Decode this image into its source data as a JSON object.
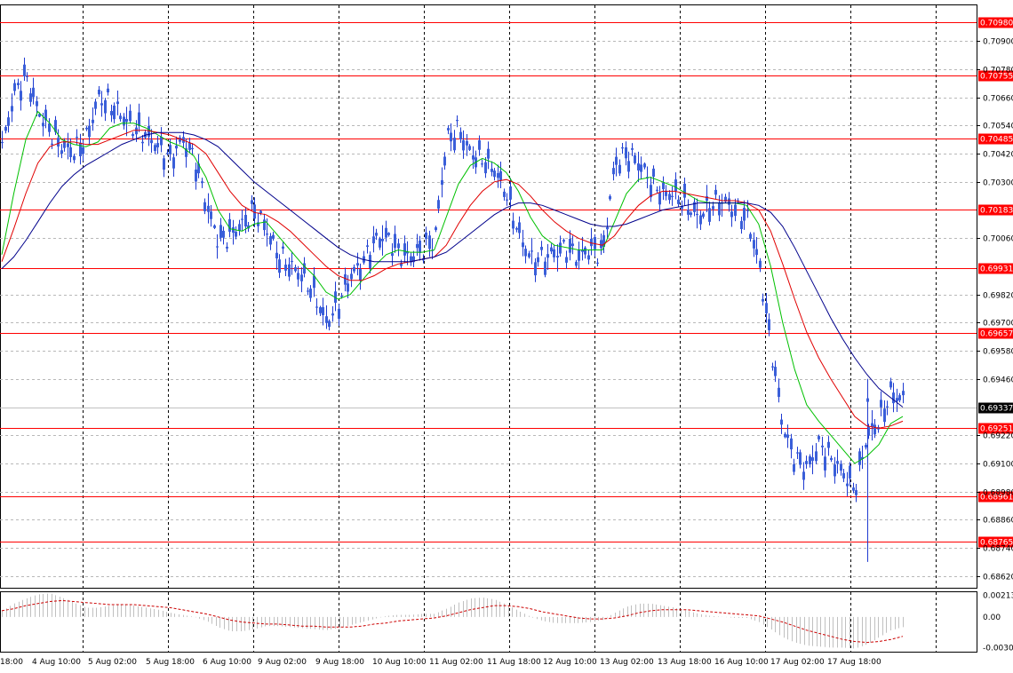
{
  "chart_data": {
    "type": "candlestick",
    "grid": true,
    "price_range": [
      0.6857,
      0.7106
    ],
    "y_ticks": [
      "0.70900",
      "0.70780",
      "0.70660",
      "0.70540",
      "0.70420",
      "0.70300",
      "0.70060",
      "0.69820",
      "0.69700",
      "0.69580",
      "0.69460",
      "0.69220",
      "0.69100",
      "0.68980",
      "0.68860",
      "0.68740",
      "0.68620"
    ],
    "level_lines": [
      "0.70980",
      "0.70755",
      "0.70485",
      "0.70183",
      "0.69931",
      "0.69657",
      "0.69251",
      "0.68961",
      "0.68765"
    ],
    "current_price": "0.69337",
    "x_labels": [
      "4 Aug 10:00",
      "5 Aug 02:00",
      "5 Aug 18:00",
      "6 Aug 10:00",
      "9 Aug 02:00",
      "9 Aug 18:00",
      "10 Aug 10:00",
      "11 Aug 02:00",
      "11 Aug 18:00",
      "12 Aug 10:00",
      "13 Aug 02:00",
      "13 Aug 18:00",
      "16 Aug 10:00",
      "17 Aug 02:00",
      "17 Aug 18:00"
    ],
    "x_label_partial": "18:00",
    "indicator": {
      "y_ticks": [
        "0.00213",
        "0.00",
        "-0.00302"
      ],
      "y_range": [
        -0.0034,
        0.0025
      ]
    },
    "series": [
      {
        "color": "#0000ff",
        "values": [
          0.7045,
          0.7068,
          0.7075,
          0.706,
          0.7052,
          0.7045,
          0.7043,
          0.7048,
          0.7066,
          0.7063,
          0.7058,
          0.7053,
          0.705,
          0.7045,
          0.704,
          0.7048,
          0.704,
          0.702,
          0.7005,
          0.7008,
          0.7012,
          0.7018,
          0.701,
          0.6998,
          0.6994,
          0.699,
          0.6982,
          0.697,
          0.6978,
          0.699,
          0.6995,
          0.7005,
          0.7007,
          0.7,
          0.6998,
          0.7002,
          0.7005,
          0.7048,
          0.7052,
          0.7042,
          0.704,
          0.7035,
          0.7025,
          0.7008,
          0.6997,
          0.6997,
          0.7,
          0.7002,
          0.6998,
          0.7002,
          0.7,
          0.7038,
          0.7042,
          0.7038,
          0.703,
          0.7025,
          0.7025,
          0.702,
          0.7015,
          0.702,
          0.7022,
          0.7018,
          0.7015,
          0.6995,
          0.696,
          0.6925,
          0.6912,
          0.6908,
          0.6918,
          0.6912,
          0.6906,
          0.6899,
          0.6922,
          0.6928,
          0.694,
          0.6937
        ]
      },
      {
        "color": "#00c000",
        "values": [
          0.6999,
          0.7025,
          0.7048,
          0.706,
          0.7055,
          0.7048,
          0.7046,
          0.7045,
          0.7047,
          0.7053,
          0.7055,
          0.7055,
          0.7053,
          0.705,
          0.7047,
          0.7045,
          0.7041,
          0.7032,
          0.7018,
          0.701,
          0.7009,
          0.7012,
          0.7013,
          0.7007,
          0.7001,
          0.6995,
          0.699,
          0.6983,
          0.698,
          0.6982,
          0.6988,
          0.6994,
          0.6999,
          0.7001,
          0.7,
          0.7,
          0.7001,
          0.7015,
          0.7029,
          0.7037,
          0.704,
          0.7038,
          0.7034,
          0.7026,
          0.7015,
          0.7007,
          0.7003,
          0.7002,
          0.7001,
          0.7001,
          0.7001,
          0.7013,
          0.7025,
          0.7031,
          0.7032,
          0.703,
          0.7028,
          0.7025,
          0.7022,
          0.7021,
          0.7021,
          0.7021,
          0.702,
          0.7012,
          0.6994,
          0.697,
          0.695,
          0.6935,
          0.6928,
          0.6922,
          0.6916,
          0.691,
          0.6913,
          0.6918,
          0.6927,
          0.693
        ]
      },
      {
        "color": "#e00000",
        "values": [
          0.6996,
          0.701,
          0.7025,
          0.7038,
          0.7045,
          0.7047,
          0.7047,
          0.7046,
          0.7046,
          0.7048,
          0.705,
          0.7052,
          0.7052,
          0.7051,
          0.705,
          0.7048,
          0.7046,
          0.7042,
          0.7034,
          0.7026,
          0.702,
          0.7017,
          0.7016,
          0.7013,
          0.7009,
          0.7004,
          0.6999,
          0.6994,
          0.699,
          0.6988,
          0.6988,
          0.699,
          0.6993,
          0.6995,
          0.6996,
          0.6997,
          0.6998,
          0.7003,
          0.7012,
          0.702,
          0.7026,
          0.703,
          0.7031,
          0.7029,
          0.7024,
          0.7018,
          0.7013,
          0.7009,
          0.7006,
          0.7004,
          0.7003,
          0.7007,
          0.7014,
          0.702,
          0.7024,
          0.7026,
          0.7026,
          0.7025,
          0.7024,
          0.7023,
          0.7022,
          0.7022,
          0.7021,
          0.7018,
          0.7009,
          0.6995,
          0.698,
          0.6966,
          0.6955,
          0.6946,
          0.6938,
          0.693,
          0.6926,
          0.6925,
          0.6926,
          0.6928
        ]
      },
      {
        "color": "#00008b",
        "values": [
          0.6993,
          0.6998,
          0.7005,
          0.7013,
          0.7021,
          0.7028,
          0.7033,
          0.7037,
          0.704,
          0.7043,
          0.7046,
          0.7048,
          0.705,
          0.7051,
          0.7051,
          0.7051,
          0.705,
          0.7048,
          0.7045,
          0.704,
          0.7035,
          0.703,
          0.7026,
          0.7022,
          0.7018,
          0.7014,
          0.701,
          0.7006,
          0.7002,
          0.6999,
          0.6997,
          0.6996,
          0.6996,
          0.6996,
          0.6996,
          0.6997,
          0.6998,
          0.7,
          0.7004,
          0.7008,
          0.7012,
          0.7016,
          0.7019,
          0.7021,
          0.7021,
          0.702,
          0.7018,
          0.7016,
          0.7014,
          0.7012,
          0.7011,
          0.7011,
          0.7012,
          0.7014,
          0.7016,
          0.7018,
          0.7019,
          0.702,
          0.7021,
          0.7021,
          0.7021,
          0.7021,
          0.7021,
          0.702,
          0.7017,
          0.7011,
          0.7002,
          0.6992,
          0.6982,
          0.6972,
          0.6963,
          0.6955,
          0.6948,
          0.6942,
          0.6938,
          0.6934
        ]
      },
      {
        "color": "#c0c0c0",
        "values": [
          0.0006,
          0.0013,
          0.0018,
          0.0022,
          0.0023,
          0.0019,
          0.0014,
          0.0009,
          0.0009,
          0.0011,
          0.0012,
          0.0011,
          0.0009,
          0.0007,
          0.0004,
          0.0002,
          0.0,
          -0.0004,
          -0.001,
          -0.0014,
          -0.0014,
          -0.0012,
          -0.0009,
          -0.0009,
          -0.001,
          -0.0011,
          -0.0012,
          -0.0013,
          -0.0011,
          -0.0008,
          -0.0005,
          -0.0002,
          0.0001,
          0.0002,
          0.0002,
          0.0003,
          0.0003,
          0.0008,
          0.0014,
          0.0018,
          0.0019,
          0.0017,
          0.0012,
          0.0006,
          0.0,
          -0.0004,
          -0.0006,
          -0.0006,
          -0.0006,
          -0.0005,
          -0.0003,
          0.0004,
          0.001,
          0.0013,
          0.0013,
          0.0011,
          0.0009,
          0.0006,
          0.0003,
          0.0001,
          0.0,
          -0.0001,
          -0.0001,
          -0.0005,
          -0.0012,
          -0.002,
          -0.0025,
          -0.0028,
          -0.0029,
          -0.003,
          -0.003,
          -0.0031,
          -0.0027,
          -0.002,
          -0.0013,
          -0.001
        ]
      },
      {
        "color": "#cc0000",
        "values": [
          0.0006,
          0.0008,
          0.0011,
          0.0013,
          0.0015,
          0.0016,
          0.0015,
          0.0014,
          0.0013,
          0.0012,
          0.0012,
          0.0012,
          0.0011,
          0.001,
          0.0009,
          0.0007,
          0.0005,
          0.0003,
          0.0,
          -0.0003,
          -0.0005,
          -0.0006,
          -0.0007,
          -0.0007,
          -0.0008,
          -0.0009,
          -0.0009,
          -0.001,
          -0.001,
          -0.001,
          -0.0009,
          -0.0007,
          -0.0006,
          -0.0004,
          -0.0003,
          -0.0002,
          -0.0001,
          0.0001,
          0.0004,
          0.0007,
          0.0009,
          0.0011,
          0.0011,
          0.001,
          0.0008,
          0.0005,
          0.0003,
          0.0001,
          -0.0001,
          -0.0002,
          -0.0002,
          -0.0001,
          0.0001,
          0.0004,
          0.0006,
          0.0007,
          0.0007,
          0.0007,
          0.0006,
          0.0005,
          0.0004,
          0.0003,
          0.0002,
          0.0001,
          -0.0002,
          -0.0005,
          -0.0009,
          -0.0013,
          -0.0016,
          -0.0019,
          -0.0022,
          -0.0024,
          -0.0025,
          -0.0024,
          -0.0022,
          -0.0019
        ]
      }
    ]
  },
  "spike": {
    "high": 0.6946,
    "low": 0.6868,
    "close": 0.6937
  }
}
